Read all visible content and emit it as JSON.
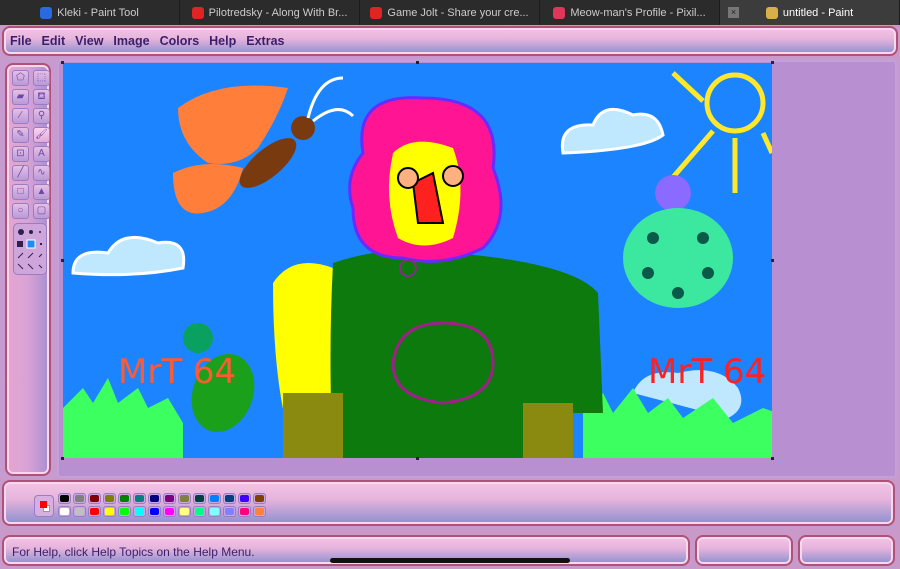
{
  "browser_tabs": [
    {
      "label": "Kleki - Paint Tool",
      "icon": "kleki-icon",
      "color": "#2a6ae0"
    },
    {
      "label": "Pilotredsky - Along With Br...",
      "icon": "youtube-icon",
      "color": "#e02424"
    },
    {
      "label": "Game Jolt - Share your cre...",
      "icon": "youtube-icon",
      "color": "#e02424"
    },
    {
      "label": "Meow-man's Profile - Pixil...",
      "icon": "heart-icon",
      "color": "#e0365a"
    },
    {
      "label": "untitled - Paint",
      "icon": "paint-icon",
      "color": "#d8b04a",
      "active": true,
      "close": "×"
    }
  ],
  "menu": [
    "File",
    "Edit",
    "View",
    "Image",
    "Colors",
    "Help",
    "Extras"
  ],
  "tools": [
    {
      "name": "free-select-icon",
      "glyph": "⬠"
    },
    {
      "name": "rect-select-icon",
      "glyph": "⬚"
    },
    {
      "name": "eraser-icon",
      "glyph": "▰"
    },
    {
      "name": "fill-icon",
      "glyph": "⛾"
    },
    {
      "name": "color-picker-icon",
      "glyph": "⁄"
    },
    {
      "name": "magnifier-icon",
      "glyph": "⚲"
    },
    {
      "name": "pencil-icon",
      "glyph": "✎"
    },
    {
      "name": "brush-icon",
      "glyph": "🖌"
    },
    {
      "name": "airbrush-icon",
      "glyph": "⊡"
    },
    {
      "name": "text-icon",
      "glyph": "A"
    },
    {
      "name": "line-icon",
      "glyph": "╱"
    },
    {
      "name": "curve-icon",
      "glyph": "∿"
    },
    {
      "name": "rectangle-icon",
      "glyph": "□"
    },
    {
      "name": "polygon-icon",
      "glyph": "▲"
    },
    {
      "name": "ellipse-icon",
      "glyph": "○"
    },
    {
      "name": "rounded-rect-icon",
      "glyph": "▢"
    }
  ],
  "selected_tool": 7,
  "palette": {
    "foreground": "#ff0000",
    "background": "#ffffff",
    "row1": [
      "#000000",
      "#808080",
      "#800000",
      "#808000",
      "#008000",
      "#008080",
      "#000080",
      "#800080",
      "#808040",
      "#004040",
      "#0080ff",
      "#004080",
      "#4000ff",
      "#804000"
    ],
    "row2": [
      "#ffffff",
      "#c0c0c0",
      "#ff0000",
      "#ffff00",
      "#00ff00",
      "#00ffff",
      "#0000ff",
      "#ff00ff",
      "#ffff80",
      "#00ff80",
      "#80ffff",
      "#8080ff",
      "#ff0080",
      "#ff8040"
    ]
  },
  "drawing": {
    "signature_left": "MrT 64",
    "signature_right": "MrT 64",
    "sky": "#1c84ff"
  },
  "status": "For Help, click Help Topics on the Help Menu."
}
